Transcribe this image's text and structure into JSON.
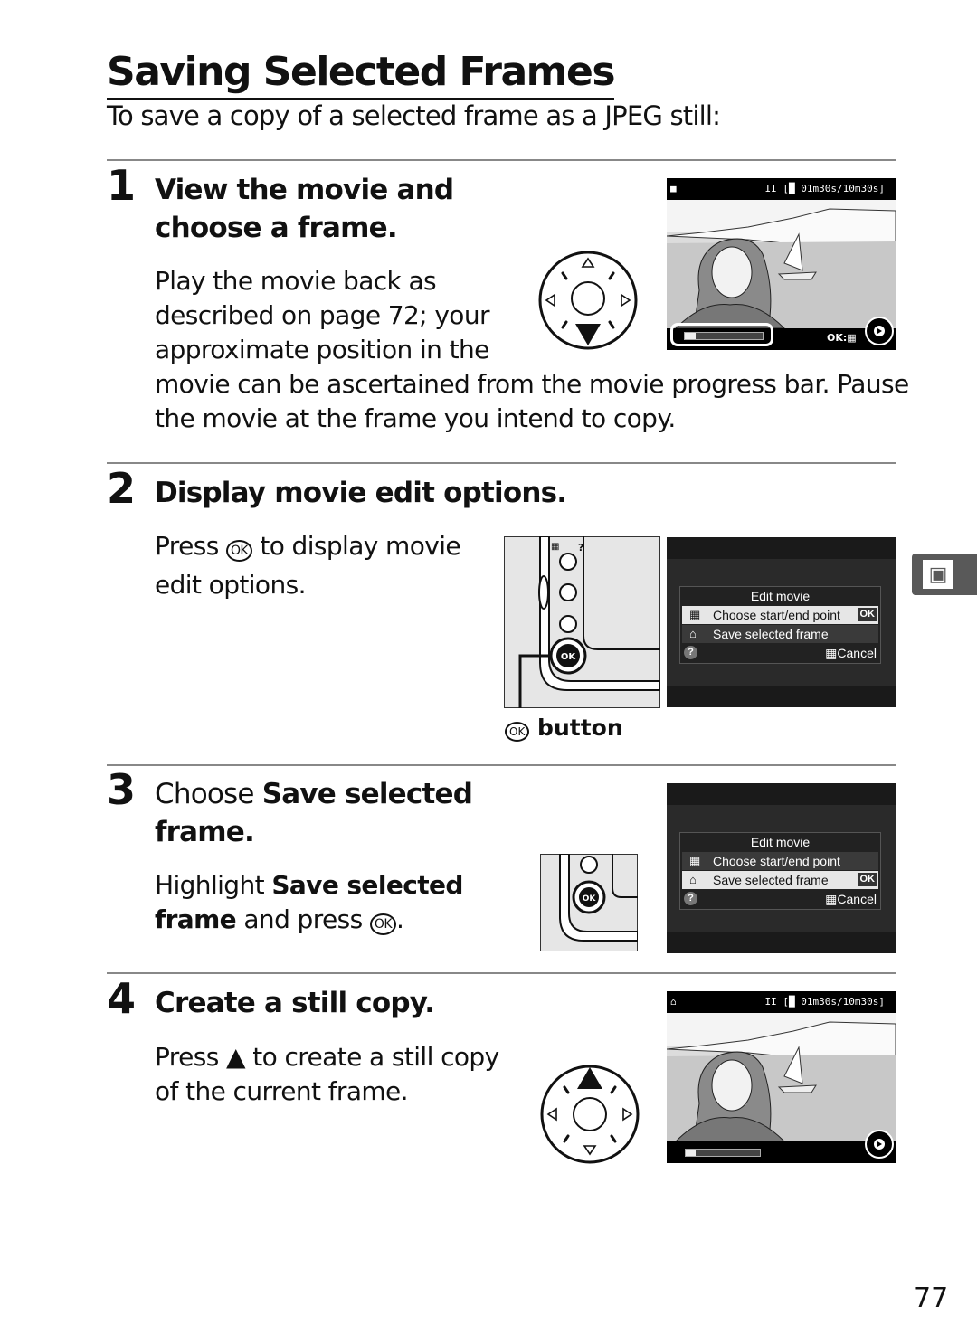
{
  "page": {
    "title": "Saving Selected Frames",
    "intro": "To save a copy of a selected frame as a JPEG still:",
    "page_number": "77",
    "side_tab_icon": "movie-camera-icon"
  },
  "steps": [
    {
      "number": "1",
      "heading_line1": "View the movie and",
      "heading_line2": "choose a frame.",
      "body_lines": [
        "Play the movie back as",
        "described on page 72; your",
        "approximate position in the",
        "movie can be ascertained from the movie progress bar.  Pause",
        "the movie at the frame you intend to copy."
      ],
      "screen": {
        "top_left_icon": "movie-icon",
        "status": "II [█ 01m30s/10m30s]",
        "progress_fraction": 0.14,
        "ok_hint": "OK:",
        "ok_hint_icon": "choose-start-end-icon"
      }
    },
    {
      "number": "2",
      "heading": "Display movie edit options.",
      "body_prefix": "Press ",
      "body_key": "OK",
      "body_suffix": " to display movie",
      "body_line2": "edit options.",
      "button_caption": "button",
      "button_caption_icon": "OK",
      "menu": {
        "title": "Edit movie",
        "items": [
          {
            "label": "Choose start/end point",
            "icon": "choose-start-end-icon",
            "selected": true
          },
          {
            "label": "Save selected frame",
            "icon": "save-frame-icon",
            "selected": false
          }
        ],
        "ok_badge": "OK",
        "help": "?",
        "cancel": "Cancel"
      }
    },
    {
      "number": "3",
      "heading_prefix": "Choose ",
      "heading_bold": "Save selected",
      "heading_line2": "frame.",
      "body_prefix": "Highlight ",
      "body_bold1": "Save selected",
      "body_bold2": "frame",
      "body_suffix": " and press ",
      "body_key": "OK",
      "menu": {
        "title": "Edit movie",
        "items": [
          {
            "label": "Choose start/end point",
            "icon": "choose-start-end-icon",
            "selected": false
          },
          {
            "label": "Save selected frame",
            "icon": "save-frame-icon",
            "selected": true
          }
        ],
        "ok_badge": "OK",
        "help": "?",
        "cancel": "Cancel"
      }
    },
    {
      "number": "4",
      "heading": "Create a still copy.",
      "body_line1_prefix": "Press ",
      "body_line1_key": "▲",
      "body_line1_suffix": " to create a still copy",
      "body_line2": "of the current frame.",
      "screen": {
        "top_left_icon": "save-frame-icon",
        "status": "II [█ 01m30s/10m30s]",
        "progress_fraction": 0.14
      }
    }
  ]
}
